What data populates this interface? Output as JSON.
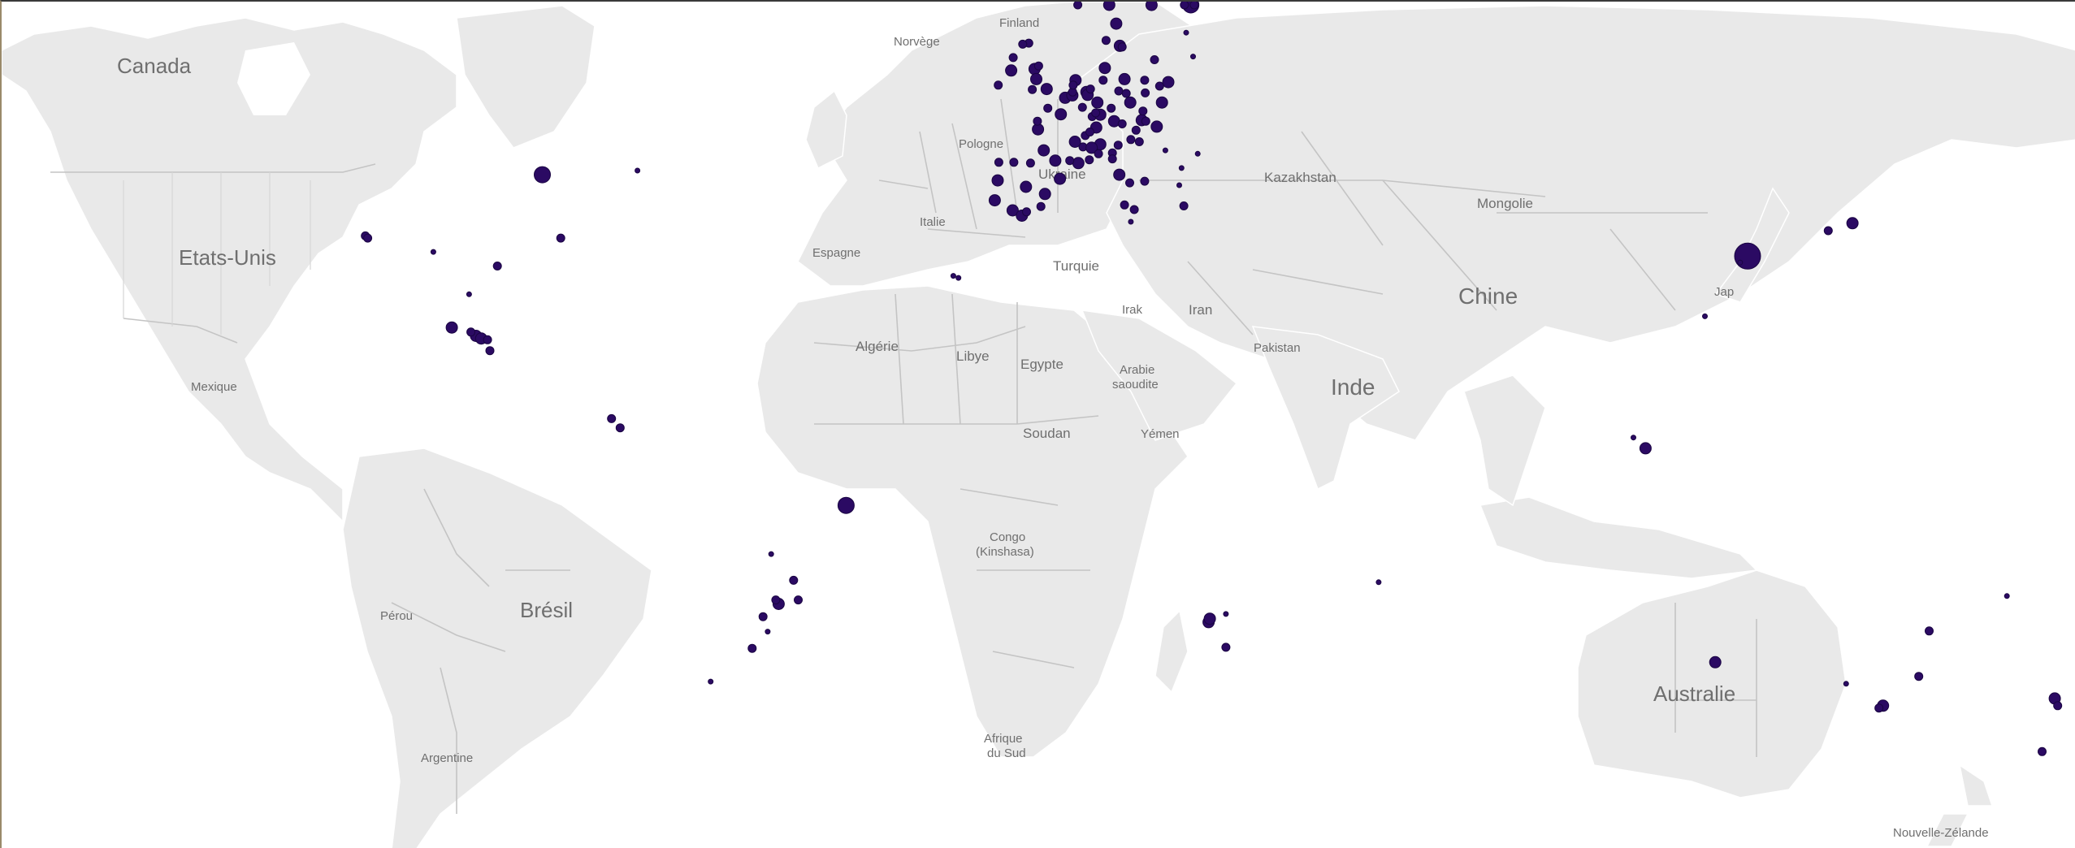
{
  "marker_color": "#2b0a63",
  "land_color": "#e9e9e9",
  "border_color": "#c4c4c4",
  "labels": {
    "canada": "Canada",
    "usa": "Etats-Unis",
    "mexico": "Mexique",
    "brazil": "Brésil",
    "peru": "Pérou",
    "argentina": "Argentine",
    "norway": "Norvège",
    "finland": "Finland",
    "poland": "Pologne",
    "ukraine": "Ukraine",
    "spain": "Espagne",
    "italy": "Italie",
    "turkey": "Turquie",
    "algeria": "Algérie",
    "libya": "Libye",
    "egypt": "Egypte",
    "saudi_1": "Arabie",
    "saudi_2": "saoudite",
    "sudan": "Soudan",
    "yemen": "Yémen",
    "congo_1": "Congo",
    "congo_2": "(Kinshasa)",
    "south_africa_1": "Afrique",
    "south_africa_2": "du Sud",
    "iraq": "Irak",
    "iran": "Iran",
    "kazakhstan": "Kazakhstan",
    "mongolia": "Mongolie",
    "china": "Chine",
    "pakistan": "Pakistan",
    "india": "Inde",
    "japan": "Jap",
    "australia": "Australie",
    "new_zealand": "Nouvelle-Zélande"
  },
  "markers": [
    {
      "lon": -87.6,
      "lat": 41.9,
      "size": "l"
    },
    {
      "lon": -118.3,
      "lat": 34.0,
      "size": "s"
    },
    {
      "lon": -117.9,
      "lat": 33.7,
      "size": "s"
    },
    {
      "lon": -84.4,
      "lat": 33.7,
      "size": "s"
    },
    {
      "lon": -71.1,
      "lat": 42.4,
      "size": "xs"
    },
    {
      "lon": -95.4,
      "lat": 29.8,
      "size": "s"
    },
    {
      "lon": -106.5,
      "lat": 31.8,
      "size": "xs"
    },
    {
      "lon": -103.3,
      "lat": 20.7,
      "size": "m"
    },
    {
      "lon": -99.1,
      "lat": 19.4,
      "size": "m"
    },
    {
      "lon": -98.2,
      "lat": 19.0,
      "size": "m"
    },
    {
      "lon": -100.3,
      "lat": 25.7,
      "size": "xs"
    },
    {
      "lon": -96.7,
      "lat": 17.1,
      "size": "s"
    },
    {
      "lon": -97.1,
      "lat": 18.8,
      "size": "s"
    },
    {
      "lon": -100.0,
      "lat": 20.0,
      "size": "s"
    },
    {
      "lon": -74.1,
      "lat": 4.7,
      "size": "s"
    },
    {
      "lon": -75.6,
      "lat": 6.2,
      "size": "s"
    },
    {
      "lon": -34.9,
      "lat": -8.0,
      "size": "l"
    },
    {
      "lon": -43.2,
      "lat": -22.9,
      "size": "s"
    },
    {
      "lon": -46.6,
      "lat": -23.5,
      "size": "m"
    },
    {
      "lon": -47.1,
      "lat": -22.9,
      "size": "s"
    },
    {
      "lon": -44.0,
      "lat": -19.9,
      "size": "s"
    },
    {
      "lon": -49.3,
      "lat": -25.4,
      "size": "s"
    },
    {
      "lon": -51.2,
      "lat": -30.0,
      "size": "s"
    },
    {
      "lon": -48.5,
      "lat": -27.6,
      "size": "xs"
    },
    {
      "lon": -47.9,
      "lat": -15.8,
      "size": "xs"
    },
    {
      "lon": -58.4,
      "lat": -34.6,
      "size": "xs"
    },
    {
      "lon": -9.1,
      "lat": 38.7,
      "size": "m"
    },
    {
      "lon": -8.6,
      "lat": 41.2,
      "size": "m"
    },
    {
      "lon": -3.7,
      "lat": 40.4,
      "size": "m"
    },
    {
      "lon": 2.2,
      "lat": 41.4,
      "size": "m"
    },
    {
      "lon": -0.4,
      "lat": 39.5,
      "size": "m"
    },
    {
      "lon": -6.0,
      "lat": 37.4,
      "size": "m"
    },
    {
      "lon": -4.4,
      "lat": 36.7,
      "size": "m"
    },
    {
      "lon": -2.9,
      "lat": 43.3,
      "size": "s"
    },
    {
      "lon": -5.8,
      "lat": 43.4,
      "size": "s"
    },
    {
      "lon": -8.4,
      "lat": 43.4,
      "size": "s"
    },
    {
      "lon": -1.1,
      "lat": 37.9,
      "size": "s"
    },
    {
      "lon": -3.6,
      "lat": 37.2,
      "size": "s"
    },
    {
      "lon": 2.35,
      "lat": 48.85,
      "size": "m"
    },
    {
      "lon": 4.8,
      "lat": 45.8,
      "size": "m"
    },
    {
      "lon": 5.4,
      "lat": 43.3,
      "size": "m"
    },
    {
      "lon": 1.4,
      "lat": 43.6,
      "size": "m"
    },
    {
      "lon": -0.6,
      "lat": 44.8,
      "size": "m"
    },
    {
      "lon": -1.6,
      "lat": 47.2,
      "size": "m"
    },
    {
      "lon": 7.3,
      "lat": 43.7,
      "size": "s"
    },
    {
      "lon": 3.1,
      "lat": 50.6,
      "size": "m"
    },
    {
      "lon": 7.8,
      "lat": 48.6,
      "size": "s"
    },
    {
      "lon": -1.7,
      "lat": 48.1,
      "size": "s"
    },
    {
      "lon": 0.1,
      "lat": 49.5,
      "size": "s"
    },
    {
      "lon": 6.2,
      "lat": 45.2,
      "size": "s"
    },
    {
      "lon": 3.9,
      "lat": 43.6,
      "size": "s"
    },
    {
      "lon": 6.6,
      "lat": 46.5,
      "size": "s"
    },
    {
      "lon": 8.5,
      "lat": 47.4,
      "size": "m"
    },
    {
      "lon": 7.4,
      "lat": 46.9,
      "size": "s"
    },
    {
      "lon": 9.2,
      "lat": 45.5,
      "size": "m"
    },
    {
      "lon": 7.7,
      "lat": 45.1,
      "size": "m"
    },
    {
      "lon": 11.3,
      "lat": 44.5,
      "size": "s"
    },
    {
      "lon": 11.3,
      "lat": 43.8,
      "size": "s"
    },
    {
      "lon": 12.5,
      "lat": 41.9,
      "size": "m"
    },
    {
      "lon": 14.3,
      "lat": 40.9,
      "size": "s"
    },
    {
      "lon": 12.3,
      "lat": 45.4,
      "size": "s"
    },
    {
      "lon": 16.9,
      "lat": 41.1,
      "size": "s"
    },
    {
      "lon": 15.1,
      "lat": 37.5,
      "size": "s"
    },
    {
      "lon": 13.4,
      "lat": 38.1,
      "size": "s"
    },
    {
      "lon": 8.9,
      "lat": 44.4,
      "size": "s"
    },
    {
      "lon": 4.35,
      "lat": 50.85,
      "size": "m"
    },
    {
      "lon": 4.4,
      "lat": 51.2,
      "size": "s"
    },
    {
      "lon": 4.9,
      "lat": 52.4,
      "size": "m"
    },
    {
      "lon": 4.5,
      "lat": 51.9,
      "size": "s"
    },
    {
      "lon": 6.1,
      "lat": 49.6,
      "size": "s"
    },
    {
      "lon": 6.8,
      "lat": 51.2,
      "size": "m"
    },
    {
      "lon": 7.0,
      "lat": 50.9,
      "size": "m"
    },
    {
      "lon": 8.7,
      "lat": 50.1,
      "size": "m"
    },
    {
      "lon": 9.2,
      "lat": 48.8,
      "size": "m"
    },
    {
      "lon": 11.6,
      "lat": 48.1,
      "size": "m"
    },
    {
      "lon": 13.4,
      "lat": 52.5,
      "size": "m"
    },
    {
      "lon": 10.0,
      "lat": 53.6,
      "size": "m"
    },
    {
      "lon": 9.7,
      "lat": 52.4,
      "size": "s"
    },
    {
      "lon": 12.4,
      "lat": 51.3,
      "size": "s"
    },
    {
      "lon": 13.7,
      "lat": 51.05,
      "size": "s"
    },
    {
      "lon": 11.1,
      "lat": 49.5,
      "size": "s"
    },
    {
      "lon": 8.4,
      "lat": 49.0,
      "size": "s"
    },
    {
      "lon": 7.5,
      "lat": 51.5,
      "size": "s"
    },
    {
      "lon": 16.4,
      "lat": 48.2,
      "size": "m"
    },
    {
      "lon": 15.4,
      "lat": 47.1,
      "size": "s"
    },
    {
      "lon": 13.0,
      "lat": 47.8,
      "size": "s"
    },
    {
      "lon": 14.4,
      "lat": 50.1,
      "size": "m"
    },
    {
      "lon": 16.6,
      "lat": 49.2,
      "size": "s"
    },
    {
      "lon": 17.1,
      "lat": 48.1,
      "size": "s"
    },
    {
      "lon": 19.0,
      "lat": 47.5,
      "size": "m"
    },
    {
      "lon": 19.9,
      "lat": 50.1,
      "size": "m"
    },
    {
      "lon": 21.0,
      "lat": 52.2,
      "size": "m"
    },
    {
      "lon": 17.0,
      "lat": 51.1,
      "size": "s"
    },
    {
      "lon": 16.9,
      "lat": 52.4,
      "size": "s"
    },
    {
      "lon": 18.6,
      "lat": 54.4,
      "size": "s"
    },
    {
      "lon": 19.5,
      "lat": 51.8,
      "size": "s"
    },
    {
      "lon": 12.6,
      "lat": 55.7,
      "size": "m"
    },
    {
      "lon": 10.2,
      "lat": 56.2,
      "size": "s"
    },
    {
      "lon": 18.1,
      "lat": 59.3,
      "size": "m"
    },
    {
      "lon": 11.97,
      "lat": 57.7,
      "size": "m"
    },
    {
      "lon": 13.0,
      "lat": 55.6,
      "size": "s"
    },
    {
      "lon": 10.75,
      "lat": 59.9,
      "size": "m"
    },
    {
      "lon": 5.3,
      "lat": 60.4,
      "size": "s"
    },
    {
      "lon": 24.9,
      "lat": 60.2,
      "size": "l"
    },
    {
      "lon": 23.8,
      "lat": 61.5,
      "size": "s"
    },
    {
      "lon": 25.5,
      "lat": 65.0,
      "size": "s"
    },
    {
      "lon": 24.1,
      "lat": 56.9,
      "size": "xs"
    },
    {
      "lon": 25.3,
      "lat": 54.7,
      "size": "xs"
    },
    {
      "lon": -0.1,
      "lat": 51.5,
      "size": "m"
    },
    {
      "lon": -2.2,
      "lat": 53.5,
      "size": "m"
    },
    {
      "lon": -1.9,
      "lat": 52.5,
      "size": "m"
    },
    {
      "lon": -1.5,
      "lat": 53.8,
      "size": "s"
    },
    {
      "lon": -3.2,
      "lat": 55.95,
      "size": "s"
    },
    {
      "lon": -4.25,
      "lat": 55.85,
      "size": "s"
    },
    {
      "lon": -2.6,
      "lat": 51.45,
      "size": "s"
    },
    {
      "lon": -6.26,
      "lat": 53.35,
      "size": "m"
    },
    {
      "lon": -8.5,
      "lat": 51.9,
      "size": "s"
    },
    {
      "lon": -5.9,
      "lat": 54.6,
      "size": "s"
    },
    {
      "lon": 23.7,
      "lat": 37.98,
      "size": "s"
    },
    {
      "lon": 22.9,
      "lat": 40.6,
      "size": "xs"
    },
    {
      "lon": 23.3,
      "lat": 42.7,
      "size": "xs"
    },
    {
      "lon": 26.1,
      "lat": 44.4,
      "size": "xs"
    },
    {
      "lon": 20.5,
      "lat": 44.8,
      "size": "xs"
    },
    {
      "lon": 15.97,
      "lat": 45.8,
      "size": "s"
    },
    {
      "lon": 14.5,
      "lat": 46.05,
      "size": "s"
    },
    {
      "lon": 14.5,
      "lat": 35.9,
      "size": "xs"
    },
    {
      "lon": -15.4,
      "lat": 28.1,
      "size": "xs"
    },
    {
      "lon": -16.3,
      "lat": 28.4,
      "size": "xs"
    },
    {
      "lon": 28.0,
      "lat": -26.2,
      "size": "m"
    },
    {
      "lon": 28.2,
      "lat": -25.7,
      "size": "m"
    },
    {
      "lon": 31.0,
      "lat": -29.85,
      "size": "s"
    },
    {
      "lon": 31.0,
      "lat": -25.0,
      "size": "xs"
    },
    {
      "lon": 57.5,
      "lat": -20.2,
      "size": "xs"
    },
    {
      "lon": 121.5,
      "lat": 31.2,
      "size": "xl"
    },
    {
      "lon": 120.2,
      "lat": 30.3,
      "size": "xs"
    },
    {
      "lon": 114.1,
      "lat": 22.4,
      "size": "xs"
    },
    {
      "lon": 103.8,
      "lat": 1.35,
      "size": "m"
    },
    {
      "lon": 101.7,
      "lat": 3.1,
      "size": "xs"
    },
    {
      "lon": 139.7,
      "lat": 35.7,
      "size": "m"
    },
    {
      "lon": 135.5,
      "lat": 34.7,
      "size": "s"
    },
    {
      "lon": 151.2,
      "lat": -33.9,
      "size": "s"
    },
    {
      "lon": 153.0,
      "lat": -27.5,
      "size": "s"
    },
    {
      "lon": 145.0,
      "lat": -37.8,
      "size": "m"
    },
    {
      "lon": 144.3,
      "lat": -38.1,
      "size": "s"
    },
    {
      "lon": 138.6,
      "lat": -34.9,
      "size": "xs"
    },
    {
      "lon": 115.9,
      "lat": -31.95,
      "size": "m"
    },
    {
      "lon": 174.8,
      "lat": -36.85,
      "size": "m"
    },
    {
      "lon": 175.3,
      "lat": -37.8,
      "size": "s"
    },
    {
      "lon": 172.6,
      "lat": -43.5,
      "size": "s"
    },
    {
      "lon": 166.5,
      "lat": -22.3,
      "size": "xs"
    }
  ]
}
